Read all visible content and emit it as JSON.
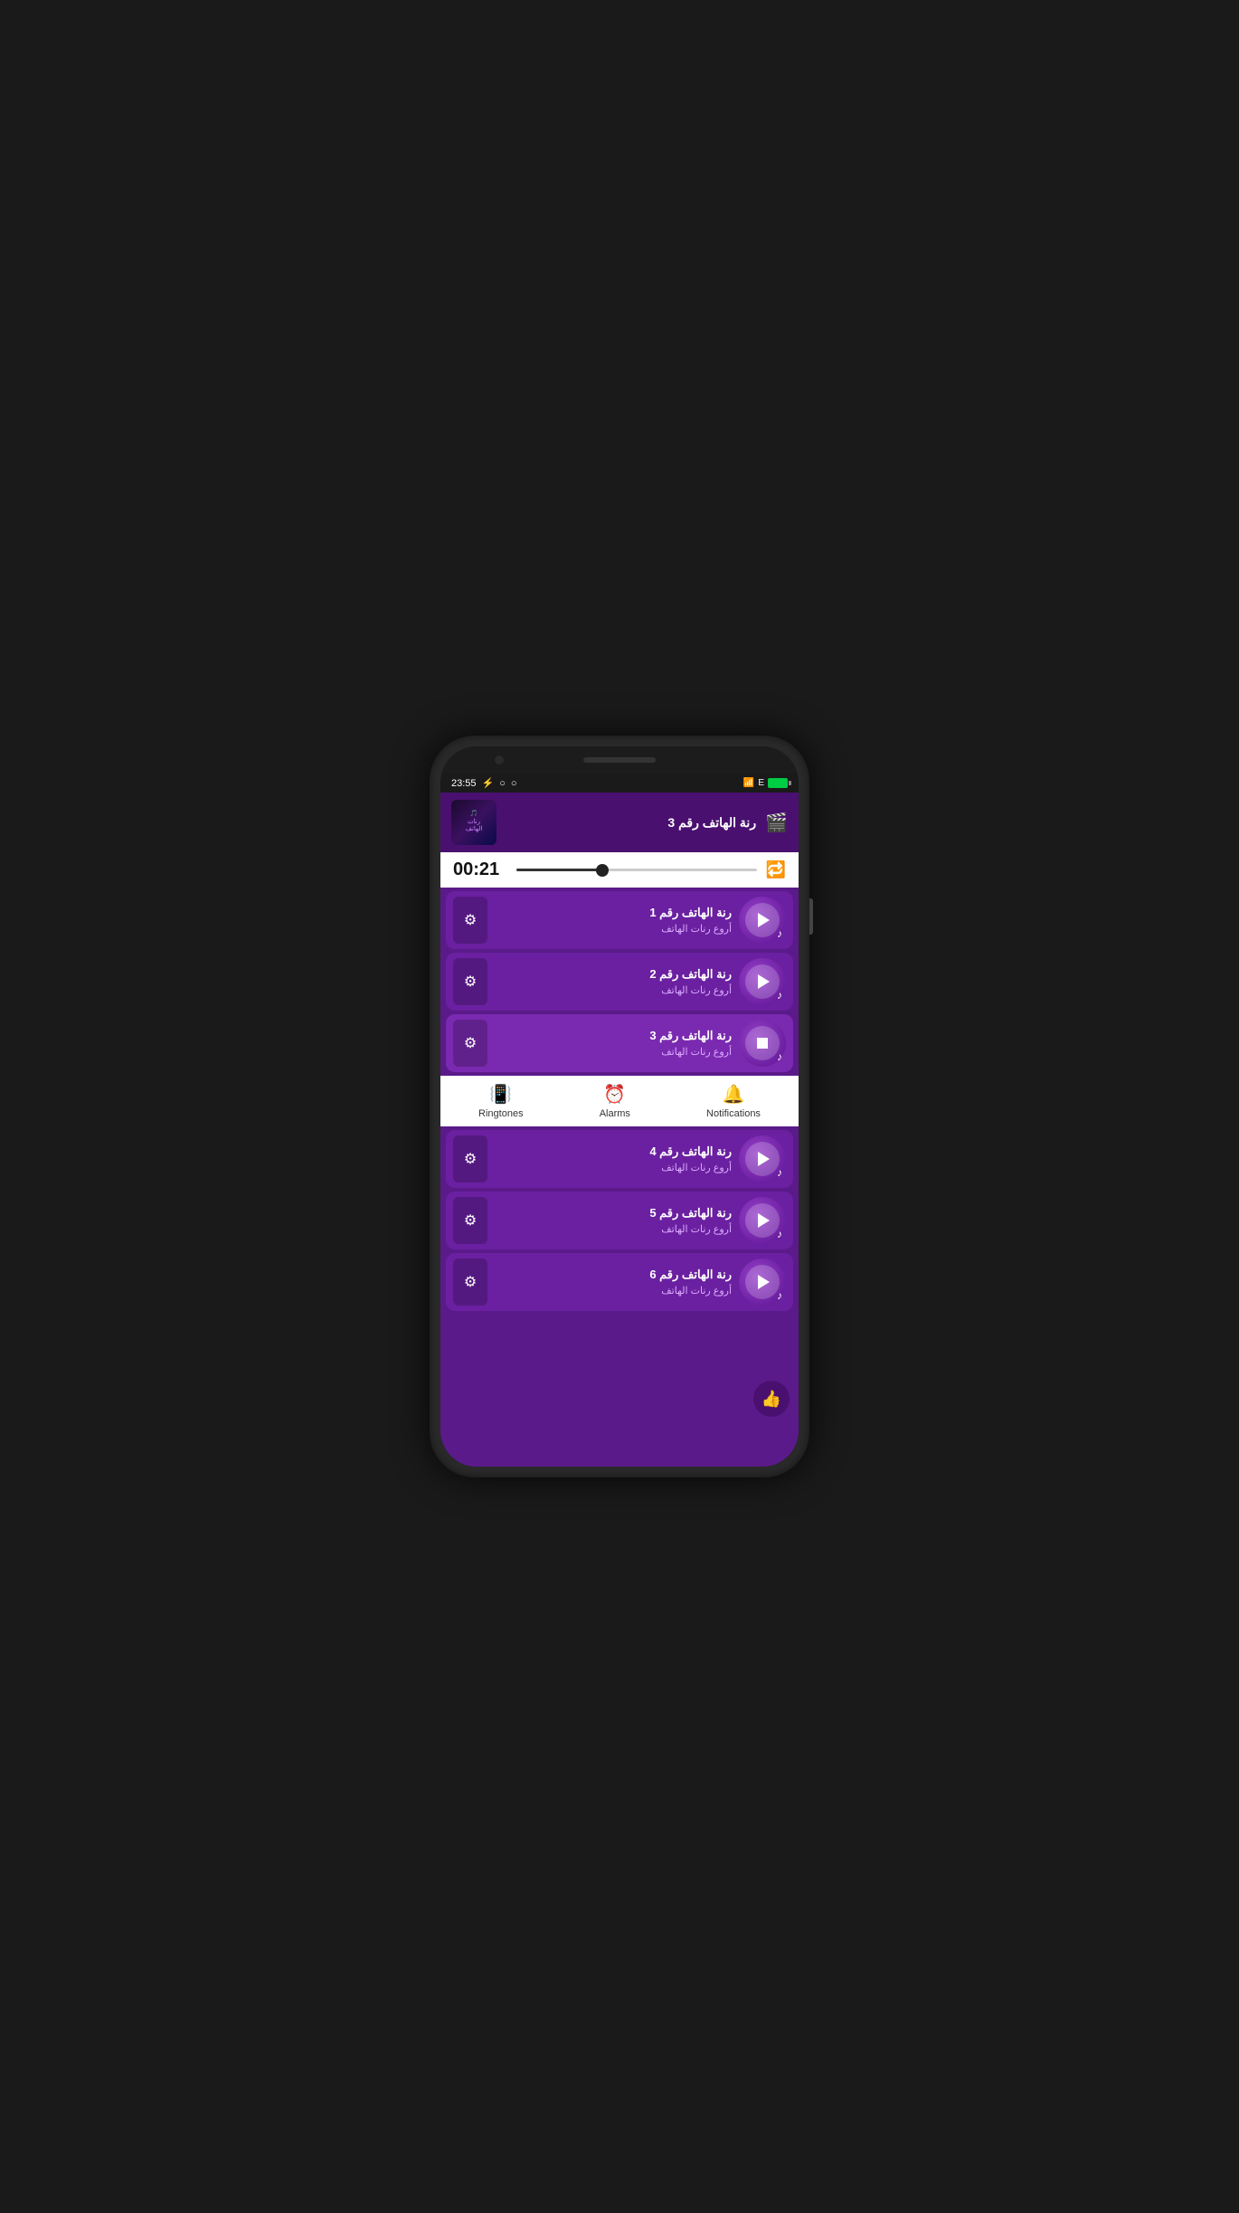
{
  "statusBar": {
    "time": "23:55",
    "signalIcon": "📶",
    "networkType": "E",
    "batteryLevel": "⚡"
  },
  "nowPlaying": {
    "title": "رنة الهاتف رقم 3",
    "albumArtText": "رنات الهاتف",
    "queueLabel": "🎬"
  },
  "player": {
    "currentTime": "00:21",
    "repeatIcon": "🔁"
  },
  "songs": [
    {
      "id": 1,
      "title": "رنة الهاتف رقم 1",
      "subtitle": "أروع رنات الهاتف",
      "state": "play"
    },
    {
      "id": 2,
      "title": "رنة الهاتف رقم 2",
      "subtitle": "أروع رنات الهاتف",
      "state": "play"
    },
    {
      "id": 3,
      "title": "رنة الهاتف رقم 3",
      "subtitle": "أروع رنات الهاتف",
      "state": "stop"
    },
    {
      "id": 4,
      "title": "رنة الهاتف رقم 4",
      "subtitle": "أروع رنات الهاتف",
      "state": "play"
    },
    {
      "id": 5,
      "title": "رنة الهاتف رقم 5",
      "subtitle": "أروع رنات الهاتف",
      "state": "play"
    },
    {
      "id": 6,
      "title": "رنة الهاتف رقم 6",
      "subtitle": "أروع رنات الهاتف",
      "state": "play"
    }
  ],
  "bottomNav": {
    "items": [
      {
        "id": "ringtones",
        "label": "Ringtones",
        "icon": "📳"
      },
      {
        "id": "alarms",
        "label": "Alarms",
        "icon": "⏰"
      },
      {
        "id": "notifications",
        "label": "Notifications",
        "icon": "🔔"
      }
    ]
  },
  "fab": {
    "icon": "👍"
  }
}
